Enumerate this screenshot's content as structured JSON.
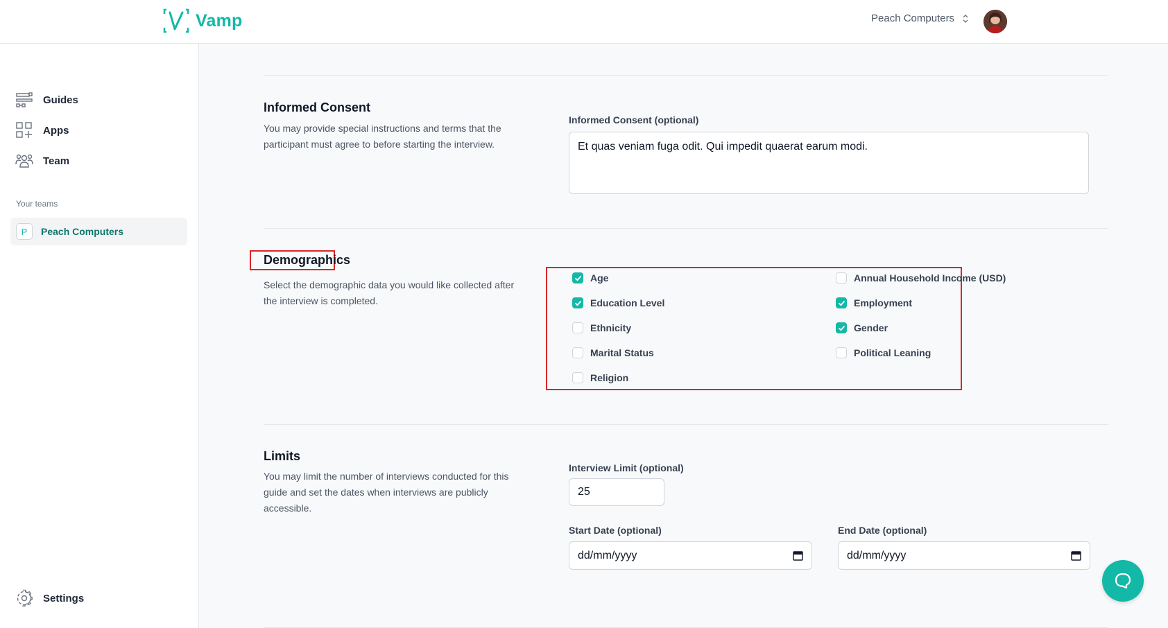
{
  "brand": {
    "name": "Vamp",
    "accent": "#14b8a6"
  },
  "header": {
    "team_name": "Peach Computers"
  },
  "sidebar": {
    "items": [
      {
        "label": "Guides",
        "icon": "guides-icon"
      },
      {
        "label": "Apps",
        "icon": "apps-icon"
      },
      {
        "label": "Team",
        "icon": "team-icon"
      }
    ],
    "teams_heading": "Your teams",
    "team": {
      "initial": "P",
      "name": "Peach Computers"
    },
    "settings_label": "Settings"
  },
  "informed_consent": {
    "title": "Informed Consent",
    "description": "You may provide special instructions and terms that the participant must agree to before starting the interview.",
    "field_label": "Informed Consent (optional)",
    "value": "Et quas veniam fuga odit. Qui impedit quaerat earum modi."
  },
  "demographics": {
    "title": "Demographics",
    "description": "Select the demographic data you would like collected after the interview is completed.",
    "options": [
      {
        "label": "Age",
        "checked": true
      },
      {
        "label": "Annual Household Income (USD)",
        "checked": false
      },
      {
        "label": "Education Level",
        "checked": true
      },
      {
        "label": "Employment",
        "checked": true
      },
      {
        "label": "Ethnicity",
        "checked": false
      },
      {
        "label": "Gender",
        "checked": true
      },
      {
        "label": "Marital Status",
        "checked": false
      },
      {
        "label": "Political Leaning",
        "checked": false
      },
      {
        "label": "Religion",
        "checked": false
      }
    ]
  },
  "limits": {
    "title": "Limits",
    "description": "You may limit the number of interviews conducted for this guide and set the dates when interviews are publicly accessible.",
    "interview_limit_label": "Interview Limit (optional)",
    "interview_limit_value": "25",
    "start_date_label": "Start Date (optional)",
    "start_date_placeholder": "dd/mm/yyyy",
    "end_date_label": "End Date (optional)",
    "end_date_placeholder": "dd/mm/yyyy"
  }
}
